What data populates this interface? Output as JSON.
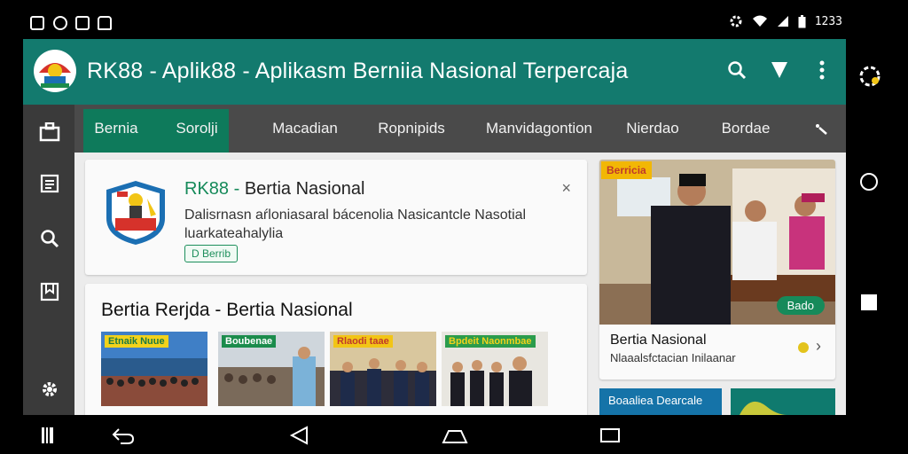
{
  "status_bar": {
    "time": "1233",
    "icons": [
      "gallery-icon",
      "settings-icon",
      "image-icon",
      "mail-icon",
      "gear-icon",
      "wifi-icon",
      "signal-icon",
      "battery-icon"
    ]
  },
  "app_bar": {
    "title": "RK88 - Aplik88 - Aplikasm Berniia Nasional Terpercaja",
    "actions": [
      "search-icon",
      "filter-icon",
      "more-vertical-icon"
    ]
  },
  "rail": {
    "items": [
      "briefcase-icon",
      "list-icon",
      "search-icon",
      "bookmark-icon",
      "gear-icon"
    ]
  },
  "tabs": [
    {
      "label": "Bernia",
      "active": true
    },
    {
      "label": "Sorolji",
      "active": true
    },
    {
      "label": "Macadian",
      "active": false
    },
    {
      "label": "Ropnipids",
      "active": false
    },
    {
      "label": "Manvidagontion",
      "active": false
    },
    {
      "label": "Nierdao",
      "active": false
    },
    {
      "label": "Bordae",
      "active": false
    }
  ],
  "notice": {
    "title_accent": "RK88 -",
    "title_rest": "Bertia Nasional",
    "description": "Dalisrnasn aŕloniasaral bácenolia Nasicantcle Nasotial luarkateahalylia",
    "badge": "D Berrib",
    "close_symbol": "×"
  },
  "section": {
    "title": "Bertia Rerjda - Bertia Nasional",
    "thumbnails": [
      {
        "label": "Etnaik Nuue",
        "label_bg": "#f2d21b",
        "label_color": "#1b7a43"
      },
      {
        "label": "Boubenae",
        "label_bg": "#1b8c4c",
        "label_color": "#ffffff"
      },
      {
        "label": "Rlaodi taae",
        "label_bg": "#f2c516",
        "label_color": "#c0392b"
      },
      {
        "label": "Bpdeit Naonmbae",
        "label_bg": "#2b9c4c",
        "label_color": "#f2d21b"
      }
    ]
  },
  "feature": {
    "tag": "Berricia",
    "badge": "Bado",
    "title": "Bertia Nasional",
    "subtitle": "Nlaaalsfctacian Inilaanar"
  },
  "bottom_cards": [
    {
      "label": "Boaaliea Dearcale",
      "bg": "#1573a8"
    },
    {
      "label": "",
      "bg": "#0f7a6e"
    }
  ],
  "right_column": {
    "buttons": [
      "chrome-icon",
      "home-circle-icon",
      "recents-square-icon"
    ]
  },
  "bottom_nav": {
    "buttons": [
      "barcode-icon",
      "return-icon",
      "back-triangle-icon",
      "home-icon",
      "recents-icon"
    ]
  },
  "colors": {
    "app_bar": "#137a6e",
    "tabs": "#4a4a4a",
    "tab_active": "#0e7a5b",
    "rail": "#3a3a3a",
    "accent_green": "#168a5a"
  }
}
